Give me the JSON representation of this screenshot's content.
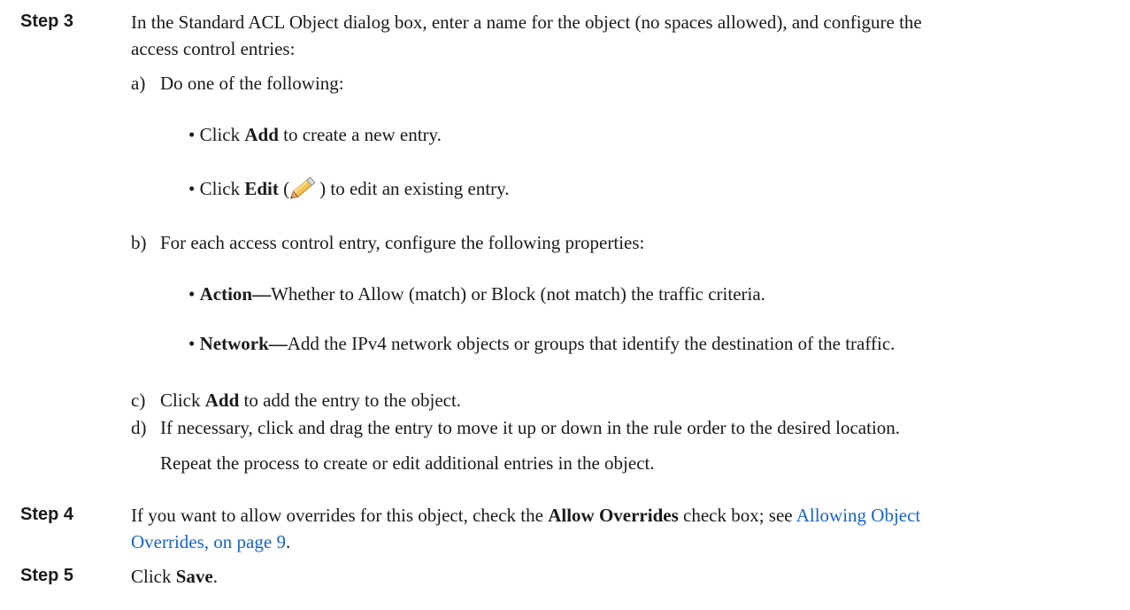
{
  "step3": {
    "label": "Step 3",
    "intro_line1": "In the Standard ACL Object dialog box, enter a name for the object (no spaces allowed), and configure the",
    "intro_line2": "access control entries:",
    "a": {
      "marker": "a)",
      "text": "Do one of the following:",
      "bullets": [
        {
          "prefix": "• Click ",
          "bold": "Add",
          "suffix": " to create a new entry."
        },
        {
          "prefix": "• Click ",
          "bold": "Edit",
          "paren_open": " (",
          "icon": "pencil-icon",
          "paren_close": ")",
          "suffix": " to edit an existing entry."
        }
      ]
    },
    "b": {
      "marker": "b)",
      "text": "For each access control entry, configure the following properties:",
      "bullets": [
        {
          "prefix": "• ",
          "bold": "Action",
          "dash": "—",
          "suffix": "Whether to Allow (match) or Block (not match) the traffic criteria."
        },
        {
          "prefix": "• ",
          "bold": "Network",
          "dash": "—",
          "suffix": "Add the IPv4 network objects or groups that identify the destination of the traffic."
        }
      ]
    },
    "c": {
      "marker": "c)",
      "prefix": "Click ",
      "bold": "Add",
      "suffix": " to add the entry to the object."
    },
    "d": {
      "marker": "d)",
      "text": "If necessary, click and drag the entry to move it up or down in the rule order to the desired location.",
      "note": "Repeat the process to create or edit additional entries in the object."
    }
  },
  "step4": {
    "label": "Step 4",
    "prefix": "If you want to allow overrides for this object, check the ",
    "bold": "Allow Overrides",
    "middle": " check box; see ",
    "link_line1": "Allowing Object",
    "link_line2": "Overrides, on page 9",
    "end": "."
  },
  "step5": {
    "label": "Step 5",
    "prefix": "Click ",
    "bold": "Save",
    "end": "."
  },
  "colors": {
    "text": "#1a1a1a",
    "link": "#1a63c6",
    "pencil_body": "#f2c14e",
    "pencil_tip": "#e8b07a"
  }
}
